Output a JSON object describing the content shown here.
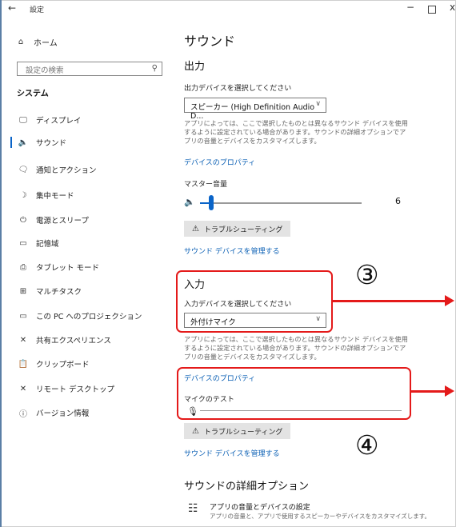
{
  "window": {
    "back": "←",
    "title": "設定",
    "min": "−",
    "close": "x"
  },
  "sidebar": {
    "home": "ホーム",
    "search_placeholder": "設定の検索",
    "section": "システム",
    "items": [
      {
        "icon": "🖵",
        "label": "ディスプレイ"
      },
      {
        "icon": "🔈",
        "label": "サウンド"
      },
      {
        "icon": "🗨",
        "label": "通知とアクション"
      },
      {
        "icon": "☽",
        "label": "集中モード"
      },
      {
        "icon": "⏻",
        "label": "電源とスリープ"
      },
      {
        "icon": "▭",
        "label": "記憶域"
      },
      {
        "icon": "⎙",
        "label": "タブレット モード"
      },
      {
        "icon": "⊞",
        "label": "マルチタスク"
      },
      {
        "icon": "▭",
        "label": "この PC へのプロジェクション"
      },
      {
        "icon": "✕",
        "label": "共有エクスペリエンス"
      },
      {
        "icon": "📋",
        "label": "クリップボード"
      },
      {
        "icon": "✕",
        "label": "リモート デスクトップ"
      },
      {
        "icon": "ⓘ",
        "label": "バージョン情報"
      }
    ]
  },
  "main": {
    "title": "サウンド",
    "output": {
      "heading": "出力",
      "select_label": "出力デバイスを選択してください",
      "device": "スピーカー (High Definition Audio D...",
      "desc": "アプリによっては、ここで選択したものとは異なるサウンド デバイスを使用するように設定されている場合があります。サウンドの詳細オプションでアプリの音量とデバイスをカスタマイズします。",
      "properties_link": "デバイスのプロパティ",
      "master_volume_label": "マスター音量",
      "volume": "6",
      "troubleshoot": "トラブルシューティング",
      "manage_link": "サウンド デバイスを管理する"
    },
    "input": {
      "heading": "入力",
      "select_label": "入力デバイスを選択してください",
      "device": "外付けマイク",
      "desc": "アプリによっては、ここで選択したものとは異なるサウンド デバイスを使用するように設定されている場合があります。サウンドの詳細オプションでアプリの音量とデバイスをカスタマイズします。",
      "properties_link": "デバイスのプロパティ",
      "mic_test_label": "マイクのテスト",
      "troubleshoot": "トラブルシューティング",
      "manage_link": "サウンド デバイスを管理する"
    },
    "advanced": {
      "heading": "サウンドの詳細オプション",
      "item_title": "アプリの音量とデバイスの設定",
      "item_desc": "アプリの音量と、アプリで使用するスピーカーやデバイスをカスタマイズします。"
    }
  },
  "annotations": {
    "three": "③",
    "four": "④",
    "color": "#e41a1a"
  }
}
